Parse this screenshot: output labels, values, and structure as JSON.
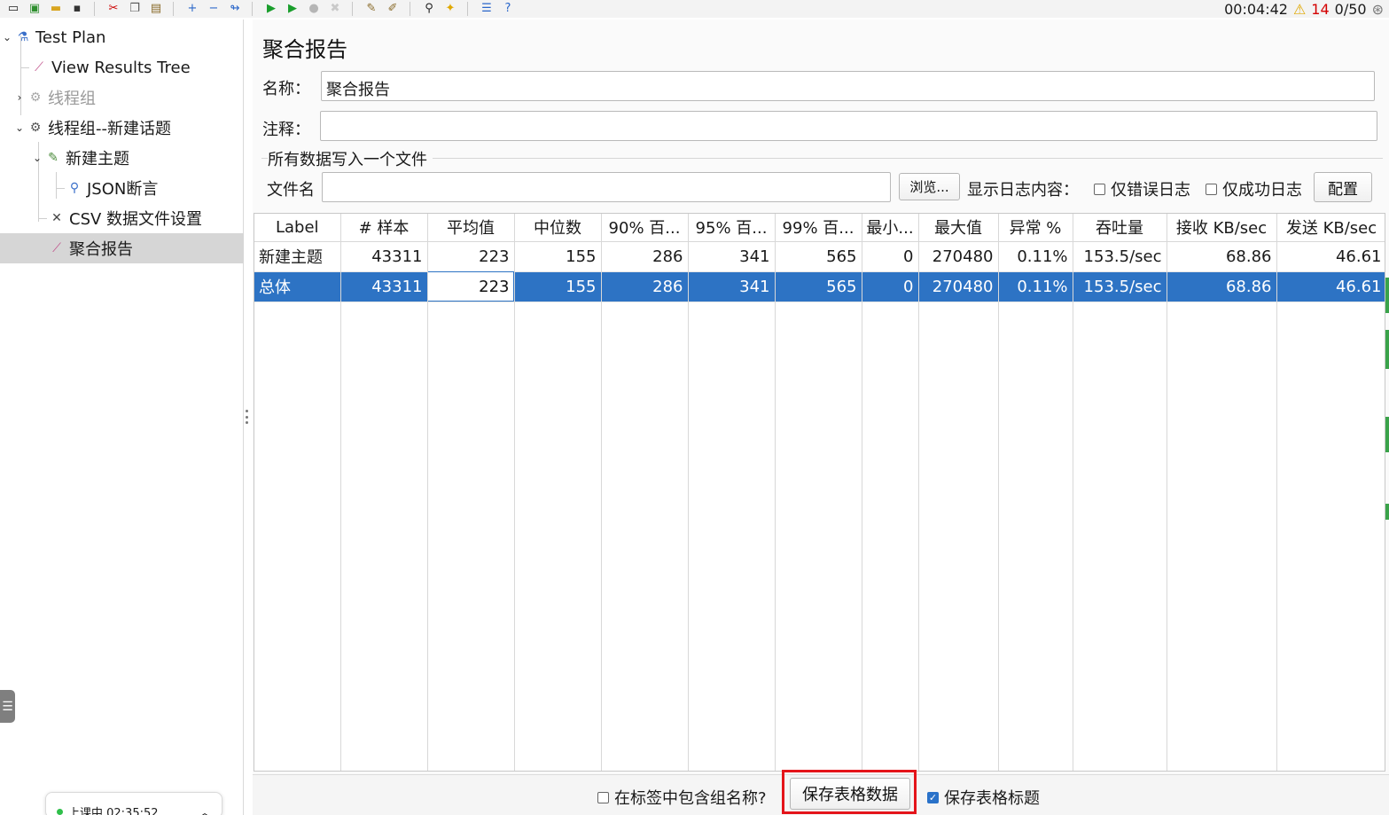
{
  "toolbar": {
    "elapsed_time": "00:04:42",
    "warning_count": "14",
    "threads": "0/50",
    "icons": [
      "new-icon",
      "templates-icon",
      "open-icon",
      "save-icon",
      "cut-icon",
      "copy-icon",
      "paste-icon",
      "expand-icon",
      "collapse-icon",
      "toggle-icon",
      "start-icon",
      "start-no-pause-icon",
      "stop-icon",
      "shutdown-icon",
      "clear-icon",
      "clear-all-icon",
      "search-icon",
      "reset-search-icon",
      "function-helper-icon",
      "help-icon"
    ]
  },
  "tree": {
    "items": [
      {
        "label": "Test Plan",
        "icon": "test-plan-icon"
      },
      {
        "label": "View Results Tree",
        "icon": "chart-icon"
      },
      {
        "label": "线程组",
        "icon": "gear-icon",
        "disabled": true
      },
      {
        "label": "线程组--新建话题",
        "icon": "gear-icon"
      },
      {
        "label": "新建主题",
        "icon": "pencil-icon"
      },
      {
        "label": "JSON断言",
        "icon": "magnifier-icon"
      },
      {
        "label": "CSV 数据文件设置",
        "icon": "tools-icon"
      },
      {
        "label": "聚合报告",
        "icon": "chart-icon",
        "selected": true
      }
    ]
  },
  "class_widget": {
    "text": "上课中 02:35:52"
  },
  "panel": {
    "title": "聚合报告",
    "name_label": "名称：",
    "name_value": "聚合报告",
    "comment_label": "注释：",
    "comment_value": "",
    "file_group_legend": "所有数据写入一个文件",
    "filename_label": "文件名",
    "filename_value": "",
    "browse_button": "浏览...",
    "log_display_label": "显示日志内容：",
    "errors_only_label": "仅错误日志",
    "success_only_label": "仅成功日志",
    "configure_button": "配置"
  },
  "table": {
    "columns": [
      "Label",
      "# 样本",
      "平均值",
      "中位数",
      "90% 百...",
      "95% 百...",
      "99% 百...",
      "最小...",
      "最大值",
      "异常 %",
      "吞吐量",
      "接收 KB/sec",
      "发送 KB/sec"
    ],
    "rows": [
      [
        "新建主题",
        "43311",
        "223",
        "155",
        "286",
        "341",
        "565",
        "0",
        "270480",
        "0.11%",
        "153.5/sec",
        "68.86",
        "46.61"
      ],
      [
        "总体",
        "43311",
        "223",
        "155",
        "286",
        "341",
        "565",
        "0",
        "270480",
        "0.11%",
        "153.5/sec",
        "68.86",
        "46.61"
      ]
    ]
  },
  "bottom": {
    "include_group_label": "在标签中包含组名称?",
    "include_group_checked": false,
    "save_table_button": "保存表格数据",
    "save_header_label": "保存表格标题",
    "save_header_checked": true
  },
  "colors": {
    "selection": "#2d73c4",
    "highlight_box": "#e4141a",
    "warning": "#d40000"
  }
}
